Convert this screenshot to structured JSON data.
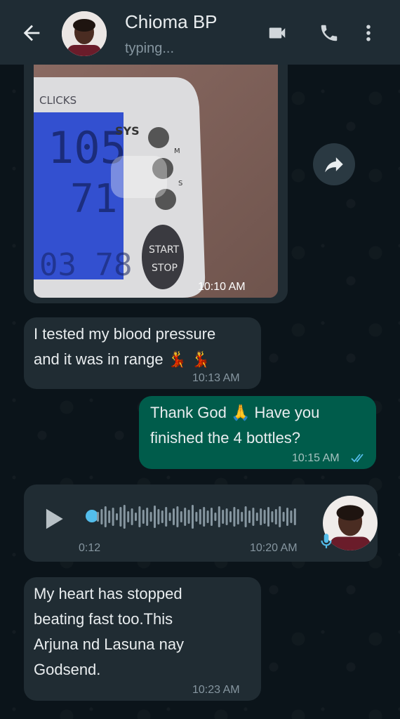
{
  "header": {
    "contact_name": "Chioma BP",
    "status": "typing..."
  },
  "icons": {
    "back": "arrow-left",
    "video": "video-camera",
    "call": "phone",
    "menu": "three-dots-vertical",
    "forward": "share-arrow",
    "play": "play-triangle",
    "mic": "microphone",
    "read_receipt": "double-check"
  },
  "colors": {
    "header_bg": "#1f2c34",
    "chat_bg": "#0b141a",
    "incoming_bubble": "#202c33",
    "outgoing_bubble": "#005c4b",
    "accent_blue": "#53bdeb"
  },
  "messages": [
    {
      "type": "image",
      "direction": "incoming",
      "time": "10:10 AM",
      "photo_text": {
        "brand": "CLICKS",
        "sys_label": "SYS",
        "button_m": "M",
        "button_s": "S",
        "start_stop": "START\nSTOP"
      }
    },
    {
      "type": "text",
      "direction": "incoming",
      "lines": [
        "I tested my blood pressure",
        "and it was in range 💃 💃"
      ],
      "time": "10:13 AM"
    },
    {
      "type": "text",
      "direction": "outgoing",
      "lines": [
        "Thank God 🙏 Have you",
        "finished the 4 bottles?"
      ],
      "time": "10:15 AM",
      "status": "read"
    },
    {
      "type": "voice",
      "direction": "incoming",
      "duration": "0:12",
      "time": "10:20 AM",
      "progress": 0.0
    },
    {
      "type": "text",
      "direction": "incoming",
      "lines": [
        "My heart has stopped",
        "beating fast too.This",
        "Arjuna nd Lasuna nay",
        "Godsend."
      ],
      "time": "10:23 AM"
    }
  ]
}
